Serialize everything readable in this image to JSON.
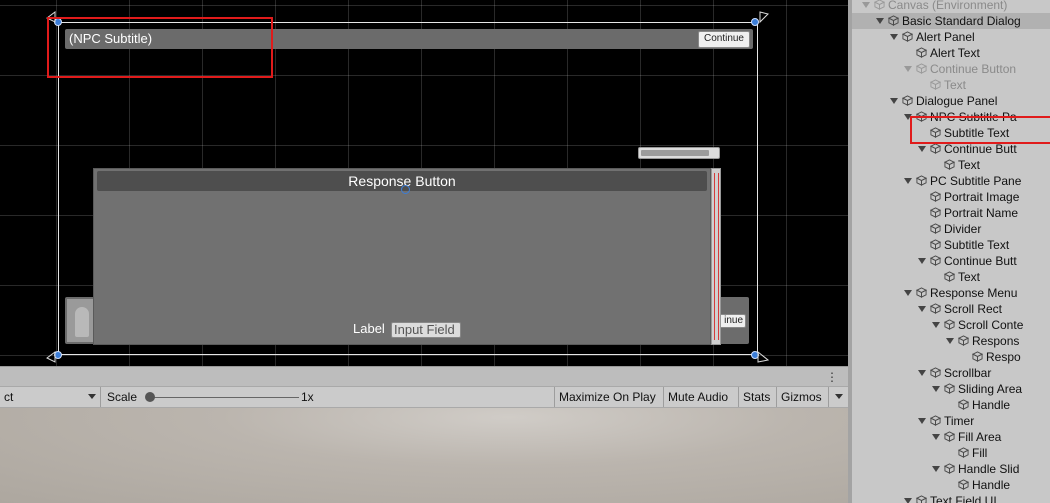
{
  "scene": {
    "npc_subtitle": "(NPC Subtitle)",
    "continue_label": "Continue",
    "response_button": "Response Button",
    "continue_partial": "inue",
    "label_text": "Label",
    "input_field_text": "Input Field"
  },
  "game_toolbar": {
    "display_dropdown": "ct",
    "scale_label": "Scale",
    "scale_value": "1x",
    "maximize_on_play": "Maximize On Play",
    "mute_audio": "Mute Audio",
    "stats": "Stats",
    "gizmos": "Gizmos",
    "menu_glyph": "⋮"
  },
  "hierarchy": {
    "items": [
      {
        "label": "Canvas (Environment)",
        "depth": 1,
        "expanded": true,
        "dim": true
      },
      {
        "label": "Basic Standard Dialog",
        "depth": 2,
        "expanded": true,
        "selected": true
      },
      {
        "label": "Alert Panel",
        "depth": 3,
        "expanded": true
      },
      {
        "label": "Alert Text",
        "depth": 4
      },
      {
        "label": "Continue Button",
        "depth": 4,
        "expanded": true,
        "dim": true
      },
      {
        "label": "Text",
        "depth": 5,
        "dim": true
      },
      {
        "label": "Dialogue Panel",
        "depth": 3,
        "expanded": true
      },
      {
        "label": "NPC Subtitle Pa",
        "depth": 4,
        "expanded": true
      },
      {
        "label": "Subtitle Text",
        "depth": 5
      },
      {
        "label": "Continue Butt",
        "depth": 5,
        "expanded": true
      },
      {
        "label": "Text",
        "depth": 6
      },
      {
        "label": "PC Subtitle Pane",
        "depth": 4,
        "expanded": true
      },
      {
        "label": "Portrait Image",
        "depth": 5
      },
      {
        "label": "Portrait Name",
        "depth": 5
      },
      {
        "label": "Divider",
        "depth": 5
      },
      {
        "label": "Subtitle Text",
        "depth": 5
      },
      {
        "label": "Continue Butt",
        "depth": 5,
        "expanded": true
      },
      {
        "label": "Text",
        "depth": 6
      },
      {
        "label": "Response Menu",
        "depth": 4,
        "expanded": true
      },
      {
        "label": "Scroll Rect",
        "depth": 5,
        "expanded": true
      },
      {
        "label": "Scroll Conte",
        "depth": 6,
        "expanded": true
      },
      {
        "label": "Respons",
        "depth": 7,
        "expanded": true
      },
      {
        "label": "Respo",
        "depth": 8
      },
      {
        "label": "Scrollbar",
        "depth": 5,
        "expanded": true
      },
      {
        "label": "Sliding Area",
        "depth": 6,
        "expanded": true
      },
      {
        "label": "Handle",
        "depth": 7
      },
      {
        "label": "Timer",
        "depth": 5,
        "expanded": true
      },
      {
        "label": "Fill Area",
        "depth": 6,
        "expanded": true
      },
      {
        "label": "Fill",
        "depth": 7
      },
      {
        "label": "Handle Slid",
        "depth": 6,
        "expanded": true
      },
      {
        "label": "Handle",
        "depth": 7
      },
      {
        "label": "Text Field UI",
        "depth": 4,
        "expanded": true
      }
    ]
  },
  "colors": {
    "highlight": "#e01b1b",
    "selection": "#3b7dd8"
  }
}
